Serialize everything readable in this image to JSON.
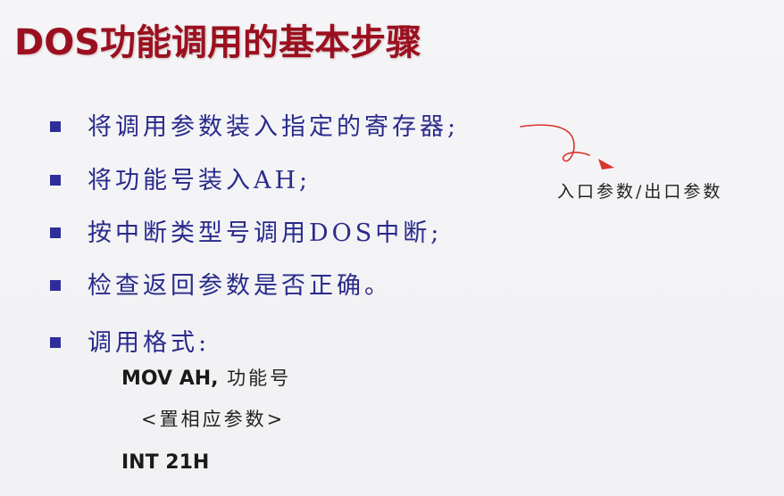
{
  "slide": {
    "title": "DOS功能调用的基本步骤",
    "bullets": [
      "将调用参数装入指定的寄存器;",
      "将功能号装入AH;",
      "按中断类型号调用DOS中断;",
      "检查返回参数是否正确。",
      "调用格式:"
    ],
    "code": {
      "line1_code": "MOV  AH,",
      "line1_suffix": " 功能号",
      "line2": "<置相应参数>",
      "line3": "INT  21H"
    },
    "annotation": "入口参数/出口参数"
  },
  "colors": {
    "title": "#9b1020",
    "bullet_text": "#2a2a8c",
    "bullet_marker": "#2e2e9a",
    "arrow": "#d9342b"
  },
  "icons": {
    "bullet": "square-bullet-icon",
    "arrow": "curved-arrow-icon"
  }
}
